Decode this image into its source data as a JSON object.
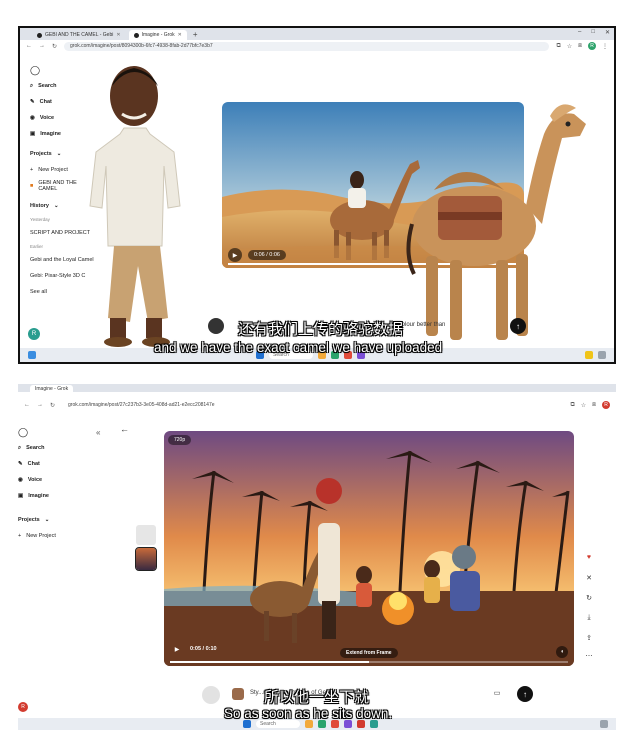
{
  "panel1": {
    "tabs": [
      {
        "label": "GEBI AND THE CAMEL - Gebi",
        "active": false
      },
      {
        "label": "Imagine - Grok",
        "active": true
      }
    ],
    "new_tab": "+",
    "window_controls": [
      "–",
      "□",
      "✕"
    ],
    "url": "grok.com/imagine/post/8094300b-6fc7-4938-8fab-2d77bfc7e3b7",
    "avatar_letter": "R",
    "sidebar": {
      "logo": "grok-logo",
      "items": [
        {
          "label": "Search",
          "icon": "search-icon"
        },
        {
          "label": "Chat",
          "icon": "chat-icon"
        },
        {
          "label": "Voice",
          "icon": "voice-icon"
        },
        {
          "label": "Imagine",
          "icon": "image-icon"
        }
      ],
      "projects_heading": "Projects",
      "projects": [
        "New Project",
        "GEBI AND THE CAMEL"
      ],
      "history_heading": "History",
      "history_groups": [
        {
          "label": "Yesterday",
          "items": [
            "SCRIPT AND PROJECT"
          ]
        },
        {
          "label": "Earlier",
          "items": [
            "Gebi and the Loyal Camel",
            "Gebi: Pixar-Style 3D C"
          ]
        }
      ],
      "see_all": "See all",
      "user_initial": "R"
    },
    "video": {
      "time": "0:06 / 0:06",
      "progress": 1.0
    },
    "prompt_text": "ert colour better than",
    "send": "↑",
    "taskbar_search": "Search",
    "subtitle_cn": "还有我们上传的骆驼数据",
    "subtitle_en": "and we have the exact camel we have uploaded"
  },
  "panel2": {
    "tabs": [
      {
        "label": "Imagine - Grok",
        "active": true
      }
    ],
    "url": "grok.com/imagine/post/27c237b3-3e05-408d-ad21-e2ecc208147e",
    "avatar_letter": "R",
    "sidebar": {
      "items": [
        {
          "label": "Search",
          "icon": "search-icon"
        },
        {
          "label": "Chat",
          "icon": "chat-icon"
        },
        {
          "label": "Voice",
          "icon": "voice-icon"
        },
        {
          "label": "Imagine",
          "icon": "image-icon"
        }
      ],
      "projects_heading": "Projects",
      "projects": [
        "New Project"
      ],
      "collapse": "«",
      "user_initial": "R"
    },
    "back": "←",
    "video": {
      "quality": "720p",
      "time": "0:05 / 0:10",
      "progress": 0.5,
      "extend_label": "Extend from Frame"
    },
    "right_actions": [
      {
        "icon": "heart-icon",
        "glyph": "♥"
      },
      {
        "icon": "close-icon",
        "glyph": "✕"
      },
      {
        "icon": "redo-icon",
        "glyph": "↻"
      },
      {
        "icon": "download-icon",
        "glyph": "⤓"
      },
      {
        "icon": "share-icon",
        "glyph": "⇪"
      },
      {
        "icon": "more-icon",
        "glyph": "⋯"
      }
    ],
    "prompt_text": "Sty...reference images of Gebi ...",
    "send": "↑",
    "taskbar_search": "Search",
    "subtitle_cn": "所以他一坐下就",
    "subtitle_en": "So as soon as he sits down."
  }
}
